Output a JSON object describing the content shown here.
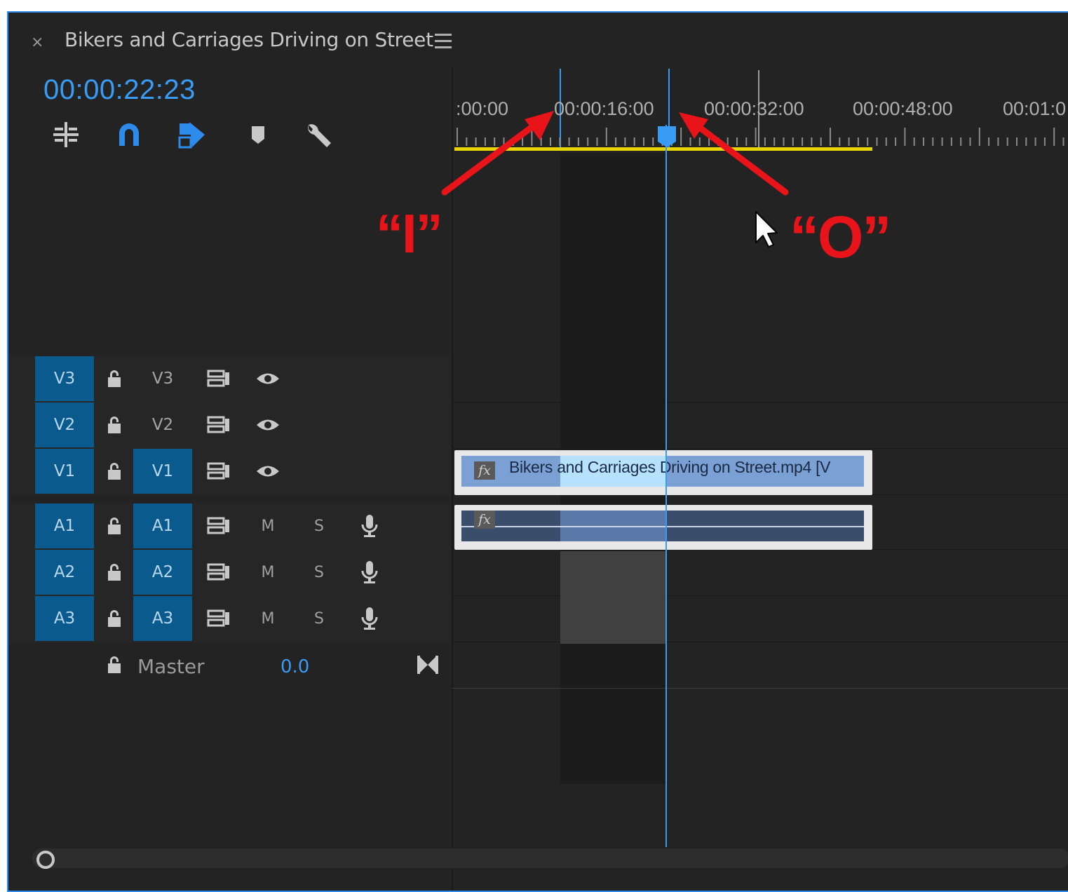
{
  "panel": {
    "close_glyph": "×",
    "sequence_title": "Bikers and Carriages Driving on Street",
    "timecode": "00:00:22:23"
  },
  "toolbar": {
    "tools": [
      "insert-nest-icon",
      "snap-magnet-icon",
      "linked-selection-icon",
      "add-marker-icon",
      "timeline-settings-wrench-icon"
    ]
  },
  "ruler": {
    "labels": [
      ":00:00",
      "00:00:16:00",
      "00:00:32:00",
      "00:00:48:00",
      "00:01:0"
    ]
  },
  "tracks": {
    "video": [
      {
        "source": "V3",
        "target": "V3",
        "target_on": false
      },
      {
        "source": "V2",
        "target": "V2",
        "target_on": false
      },
      {
        "source": "V1",
        "target": "V1",
        "target_on": true
      }
    ],
    "audio": [
      {
        "source": "A1",
        "target": "A1",
        "mute": "M",
        "solo": "S"
      },
      {
        "source": "A2",
        "target": "A2",
        "mute": "M",
        "solo": "S"
      },
      {
        "source": "A3",
        "target": "A3",
        "mute": "M",
        "solo": "S"
      }
    ],
    "master": {
      "label": "Master",
      "value": "0.0"
    }
  },
  "clips": {
    "video_name": "Bikers and Carriages Driving on Street.mp4 [V",
    "fx_label": "fx"
  },
  "annotations": {
    "in_label": "“I”",
    "out_label": "“O”"
  },
  "colors": {
    "accent": "#3a9bf5",
    "track_target": "#0b5a8e",
    "work_area": "#e8d400",
    "annotation": "#e8141a"
  }
}
